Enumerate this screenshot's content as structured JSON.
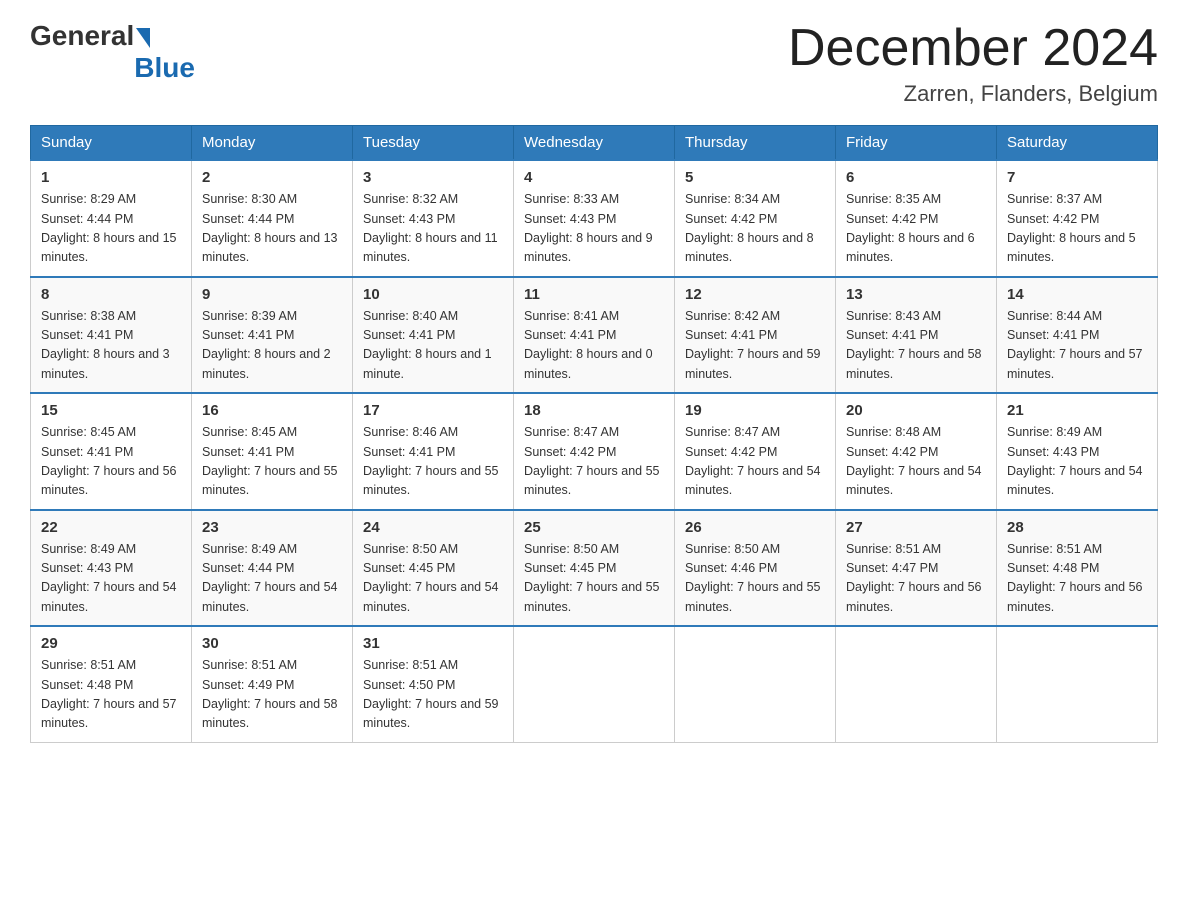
{
  "header": {
    "logo_general": "General",
    "logo_blue": "Blue",
    "month_title": "December 2024",
    "location": "Zarren, Flanders, Belgium"
  },
  "days_of_week": [
    "Sunday",
    "Monday",
    "Tuesday",
    "Wednesday",
    "Thursday",
    "Friday",
    "Saturday"
  ],
  "weeks": [
    [
      {
        "day": "1",
        "sunrise": "8:29 AM",
        "sunset": "4:44 PM",
        "daylight": "8 hours and 15 minutes."
      },
      {
        "day": "2",
        "sunrise": "8:30 AM",
        "sunset": "4:44 PM",
        "daylight": "8 hours and 13 minutes."
      },
      {
        "day": "3",
        "sunrise": "8:32 AM",
        "sunset": "4:43 PM",
        "daylight": "8 hours and 11 minutes."
      },
      {
        "day": "4",
        "sunrise": "8:33 AM",
        "sunset": "4:43 PM",
        "daylight": "8 hours and 9 minutes."
      },
      {
        "day": "5",
        "sunrise": "8:34 AM",
        "sunset": "4:42 PM",
        "daylight": "8 hours and 8 minutes."
      },
      {
        "day": "6",
        "sunrise": "8:35 AM",
        "sunset": "4:42 PM",
        "daylight": "8 hours and 6 minutes."
      },
      {
        "day": "7",
        "sunrise": "8:37 AM",
        "sunset": "4:42 PM",
        "daylight": "8 hours and 5 minutes."
      }
    ],
    [
      {
        "day": "8",
        "sunrise": "8:38 AM",
        "sunset": "4:41 PM",
        "daylight": "8 hours and 3 minutes."
      },
      {
        "day": "9",
        "sunrise": "8:39 AM",
        "sunset": "4:41 PM",
        "daylight": "8 hours and 2 minutes."
      },
      {
        "day": "10",
        "sunrise": "8:40 AM",
        "sunset": "4:41 PM",
        "daylight": "8 hours and 1 minute."
      },
      {
        "day": "11",
        "sunrise": "8:41 AM",
        "sunset": "4:41 PM",
        "daylight": "8 hours and 0 minutes."
      },
      {
        "day": "12",
        "sunrise": "8:42 AM",
        "sunset": "4:41 PM",
        "daylight": "7 hours and 59 minutes."
      },
      {
        "day": "13",
        "sunrise": "8:43 AM",
        "sunset": "4:41 PM",
        "daylight": "7 hours and 58 minutes."
      },
      {
        "day": "14",
        "sunrise": "8:44 AM",
        "sunset": "4:41 PM",
        "daylight": "7 hours and 57 minutes."
      }
    ],
    [
      {
        "day": "15",
        "sunrise": "8:45 AM",
        "sunset": "4:41 PM",
        "daylight": "7 hours and 56 minutes."
      },
      {
        "day": "16",
        "sunrise": "8:45 AM",
        "sunset": "4:41 PM",
        "daylight": "7 hours and 55 minutes."
      },
      {
        "day": "17",
        "sunrise": "8:46 AM",
        "sunset": "4:41 PM",
        "daylight": "7 hours and 55 minutes."
      },
      {
        "day": "18",
        "sunrise": "8:47 AM",
        "sunset": "4:42 PM",
        "daylight": "7 hours and 55 minutes."
      },
      {
        "day": "19",
        "sunrise": "8:47 AM",
        "sunset": "4:42 PM",
        "daylight": "7 hours and 54 minutes."
      },
      {
        "day": "20",
        "sunrise": "8:48 AM",
        "sunset": "4:42 PM",
        "daylight": "7 hours and 54 minutes."
      },
      {
        "day": "21",
        "sunrise": "8:49 AM",
        "sunset": "4:43 PM",
        "daylight": "7 hours and 54 minutes."
      }
    ],
    [
      {
        "day": "22",
        "sunrise": "8:49 AM",
        "sunset": "4:43 PM",
        "daylight": "7 hours and 54 minutes."
      },
      {
        "day": "23",
        "sunrise": "8:49 AM",
        "sunset": "4:44 PM",
        "daylight": "7 hours and 54 minutes."
      },
      {
        "day": "24",
        "sunrise": "8:50 AM",
        "sunset": "4:45 PM",
        "daylight": "7 hours and 54 minutes."
      },
      {
        "day": "25",
        "sunrise": "8:50 AM",
        "sunset": "4:45 PM",
        "daylight": "7 hours and 55 minutes."
      },
      {
        "day": "26",
        "sunrise": "8:50 AM",
        "sunset": "4:46 PM",
        "daylight": "7 hours and 55 minutes."
      },
      {
        "day": "27",
        "sunrise": "8:51 AM",
        "sunset": "4:47 PM",
        "daylight": "7 hours and 56 minutes."
      },
      {
        "day": "28",
        "sunrise": "8:51 AM",
        "sunset": "4:48 PM",
        "daylight": "7 hours and 56 minutes."
      }
    ],
    [
      {
        "day": "29",
        "sunrise": "8:51 AM",
        "sunset": "4:48 PM",
        "daylight": "7 hours and 57 minutes."
      },
      {
        "day": "30",
        "sunrise": "8:51 AM",
        "sunset": "4:49 PM",
        "daylight": "7 hours and 58 minutes."
      },
      {
        "day": "31",
        "sunrise": "8:51 AM",
        "sunset": "4:50 PM",
        "daylight": "7 hours and 59 minutes."
      },
      null,
      null,
      null,
      null
    ]
  ],
  "labels": {
    "sunrise": "Sunrise:",
    "sunset": "Sunset:",
    "daylight": "Daylight:"
  }
}
